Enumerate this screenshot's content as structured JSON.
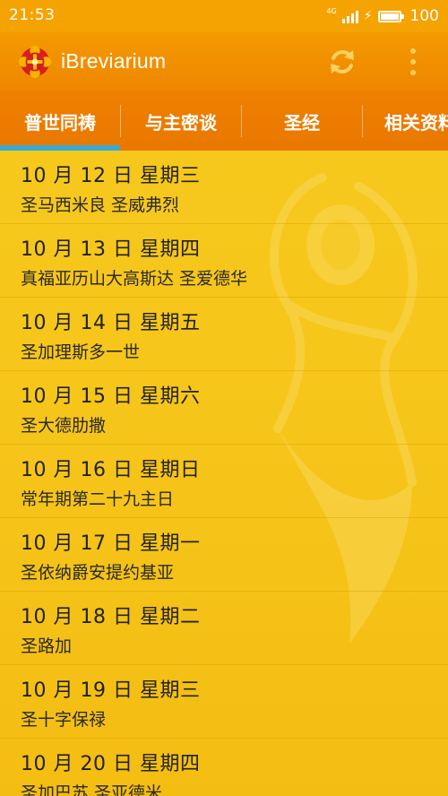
{
  "status_bar": {
    "time": "21:53",
    "network": "4G",
    "battery_level": "100",
    "battery_fraction": 1.0,
    "signal_bars": 4
  },
  "app_bar": {
    "title": "iBreviarium",
    "logo_icon": "cross-seal-icon",
    "refresh_icon": "refresh-icon",
    "more_icon": "more-vertical-icon"
  },
  "tabs": [
    {
      "label": "普世同祷",
      "selected": true
    },
    {
      "label": "与主密谈",
      "selected": false
    },
    {
      "label": "圣经",
      "selected": false
    },
    {
      "label": "相关资料",
      "selected": false
    }
  ],
  "days": [
    {
      "date": "10 月 12 日 星期三",
      "feast": "圣马西米良  圣威弗烈"
    },
    {
      "date": "10 月 13 日 星期四",
      "feast": "真福亚历山大高斯达  圣爱德华"
    },
    {
      "date": "10 月 14 日 星期五",
      "feast": "圣加理斯多一世"
    },
    {
      "date": "10 月 15 日 星期六",
      "feast": "圣大德肋撒"
    },
    {
      "date": "10 月 16 日 星期日",
      "feast": "常年期第二十九主日"
    },
    {
      "date": "10 月 17 日 星期一",
      "feast": "圣依纳爵安提约基亚"
    },
    {
      "date": "10 月 18 日 星期二",
      "feast": "圣路加"
    },
    {
      "date": "10 月 19 日 星期三",
      "feast": "圣十字保禄"
    },
    {
      "date": "10 月 20 日 星期四",
      "feast": "圣加巴苏  圣亚德米"
    }
  ],
  "colors": {
    "status_bar": "#f5a300",
    "app_bar": "#f08a00",
    "tab_bar": "#ec7c00",
    "tab_indicator": "#36a9d4",
    "list_background": "#f7c91d"
  }
}
